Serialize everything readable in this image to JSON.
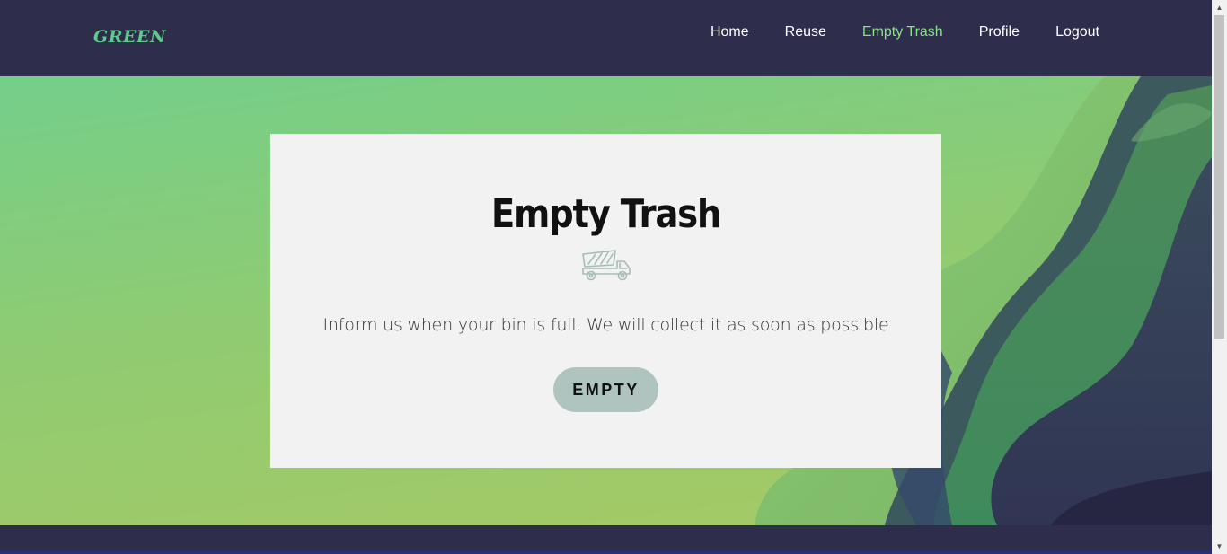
{
  "header": {
    "logo": "GREEN",
    "nav": [
      {
        "label": "Home",
        "active": false
      },
      {
        "label": "Reuse",
        "active": false
      },
      {
        "label": "Empty Trash",
        "active": true
      },
      {
        "label": "Profile",
        "active": false
      },
      {
        "label": "Logout",
        "active": false
      }
    ]
  },
  "main": {
    "title": "Empty Trash",
    "icon": "dump-truck-icon",
    "description": "Inform us when your bin is full. We will collect it as soon as possible",
    "button_label": "EMPTY"
  },
  "colors": {
    "navbar": "#2e2d4b",
    "logo": "#5ec98a",
    "nav_active": "#8ae08a",
    "card": "#f2f2f2",
    "button": "#b0c4bf"
  },
  "scrollbar": {
    "up_arrow": "▲",
    "down_arrow": "▼"
  }
}
